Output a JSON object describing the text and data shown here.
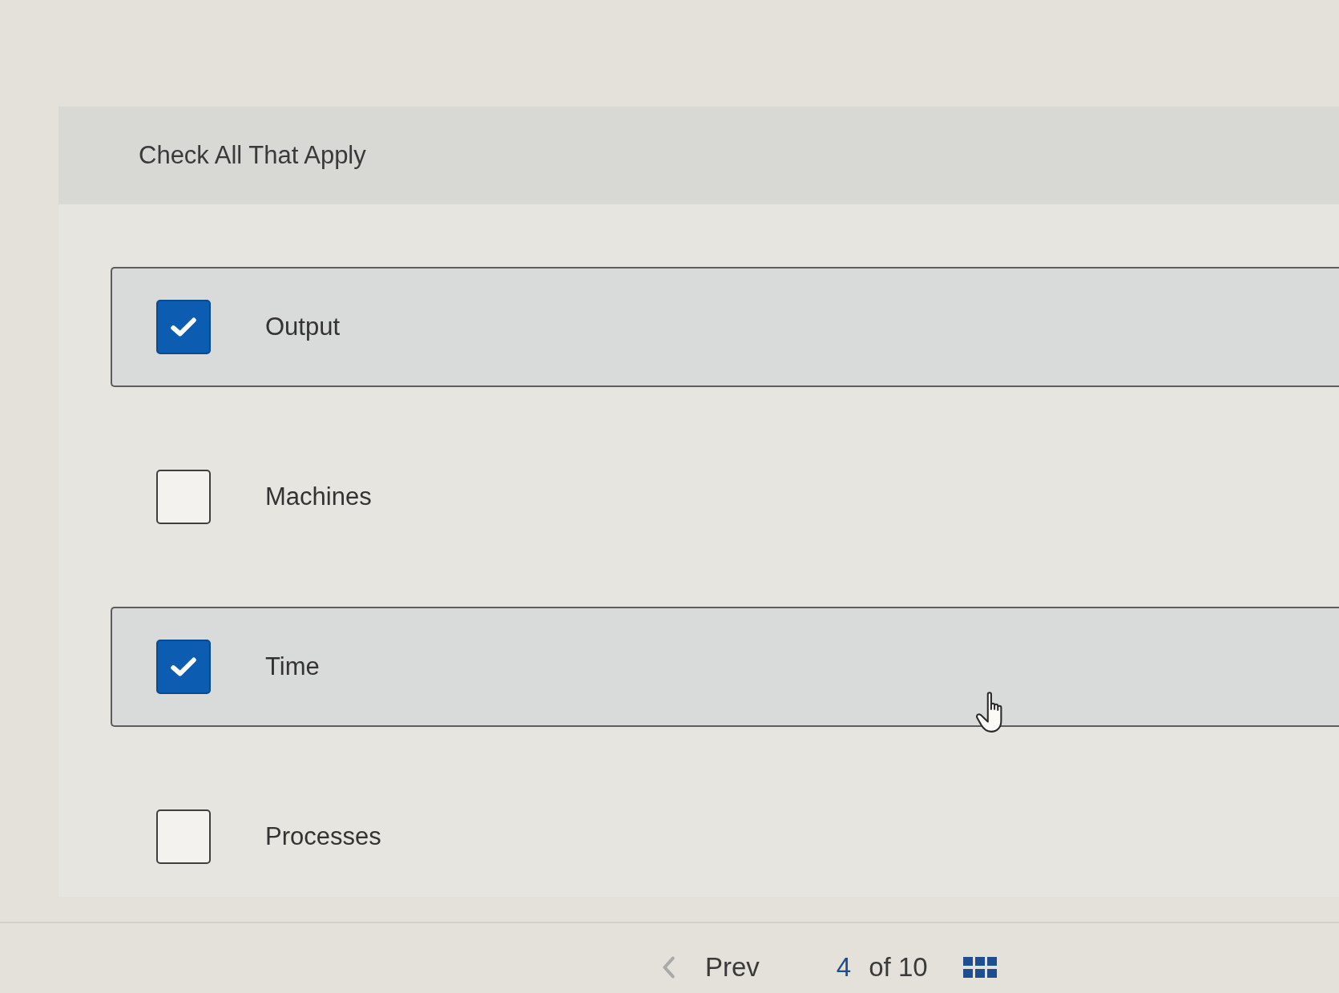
{
  "question": {
    "instruction": "Check All That Apply"
  },
  "options": [
    {
      "label": "Output",
      "checked": true
    },
    {
      "label": "Machines",
      "checked": false
    },
    {
      "label": "Time",
      "checked": true
    },
    {
      "label": "Processes",
      "checked": false
    }
  ],
  "navigation": {
    "prev_label": "Prev",
    "current_page": "4",
    "page_total": "of 10"
  }
}
